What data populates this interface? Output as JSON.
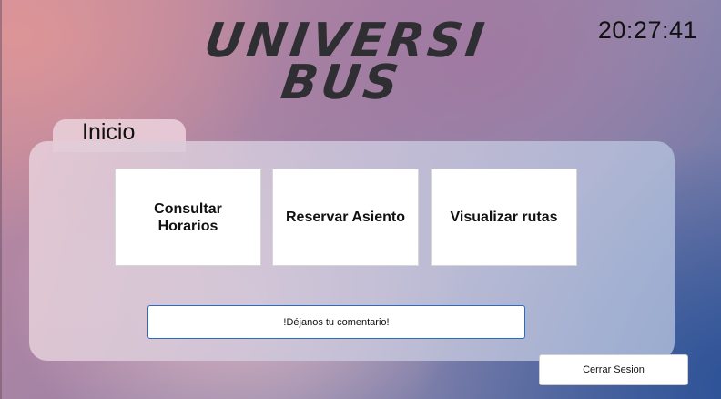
{
  "app": {
    "logo_line1": "UNIVERSI",
    "logo_line2": "BUS"
  },
  "clock": {
    "time": "20:27:41"
  },
  "section": {
    "tab_label": "Inicio"
  },
  "menu": {
    "items": [
      {
        "label": "Consultar Horarios"
      },
      {
        "label": "Reservar Asiento"
      },
      {
        "label": "Visualizar rutas"
      }
    ]
  },
  "comment": {
    "button_label": "!Déjanos tu comentario!"
  },
  "session": {
    "logout_label": "Cerrar Sesion"
  },
  "colors": {
    "logo_text": "#2f2f33",
    "comment_border": "#2a6cc4",
    "card_background": "#ffffff"
  }
}
